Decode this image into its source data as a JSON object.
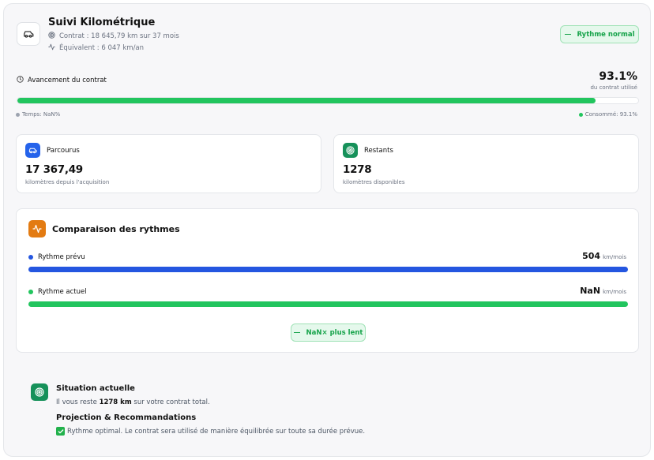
{
  "header": {
    "title": "Suivi Kilométrique",
    "contract": "Contrat : 18 645,79 km sur 37 mois",
    "equivalent": "Équivalent : 6 047 km/an",
    "status_badge": "Rythme normal",
    "icon": "car-icon"
  },
  "progress": {
    "label": "Avancement du contrat",
    "percent_text": "93.1%",
    "percent_value": 0.931,
    "sub": "du contrat utilisé",
    "legend_time": "Temps: NaN%",
    "legend_consumed": "Consommé: 93.1%"
  },
  "stats": {
    "parcourus": {
      "label": "Parcourus",
      "value": "17 367,49",
      "note": "kilomètres depuis l'acquisition",
      "icon": "car-icon",
      "color": "#2563eb"
    },
    "restants": {
      "label": "Restants",
      "value": "1278",
      "note": "kilomètres disponibles",
      "icon": "target-icon",
      "color": "#16915a"
    }
  },
  "comparison": {
    "title": "Comparaison des rythmes",
    "icon": "activity-icon",
    "planned": {
      "label": "Rythme prévu",
      "value": "504",
      "unit": "km/mois",
      "color": "#2456e0"
    },
    "actual": {
      "label": "Rythme actuel",
      "value": "NaN",
      "unit": "km/mois",
      "color": "#22c55e"
    },
    "badge": "NaN× plus lent"
  },
  "situation": {
    "title": "Situation actuelle",
    "text_before": "Il vous reste",
    "remaining": "1278 km",
    "text_after": "sur votre contrat total.",
    "projection_title": "Projection & Recommandations",
    "projection_text": "Rythme optimal. Le contrat sera utilisé de manière équilibrée sur toute sa durée prévue."
  },
  "colors": {
    "accent_green": "#22c55e",
    "accent_blue": "#2456e0",
    "accent_orange": "#e37b12"
  }
}
